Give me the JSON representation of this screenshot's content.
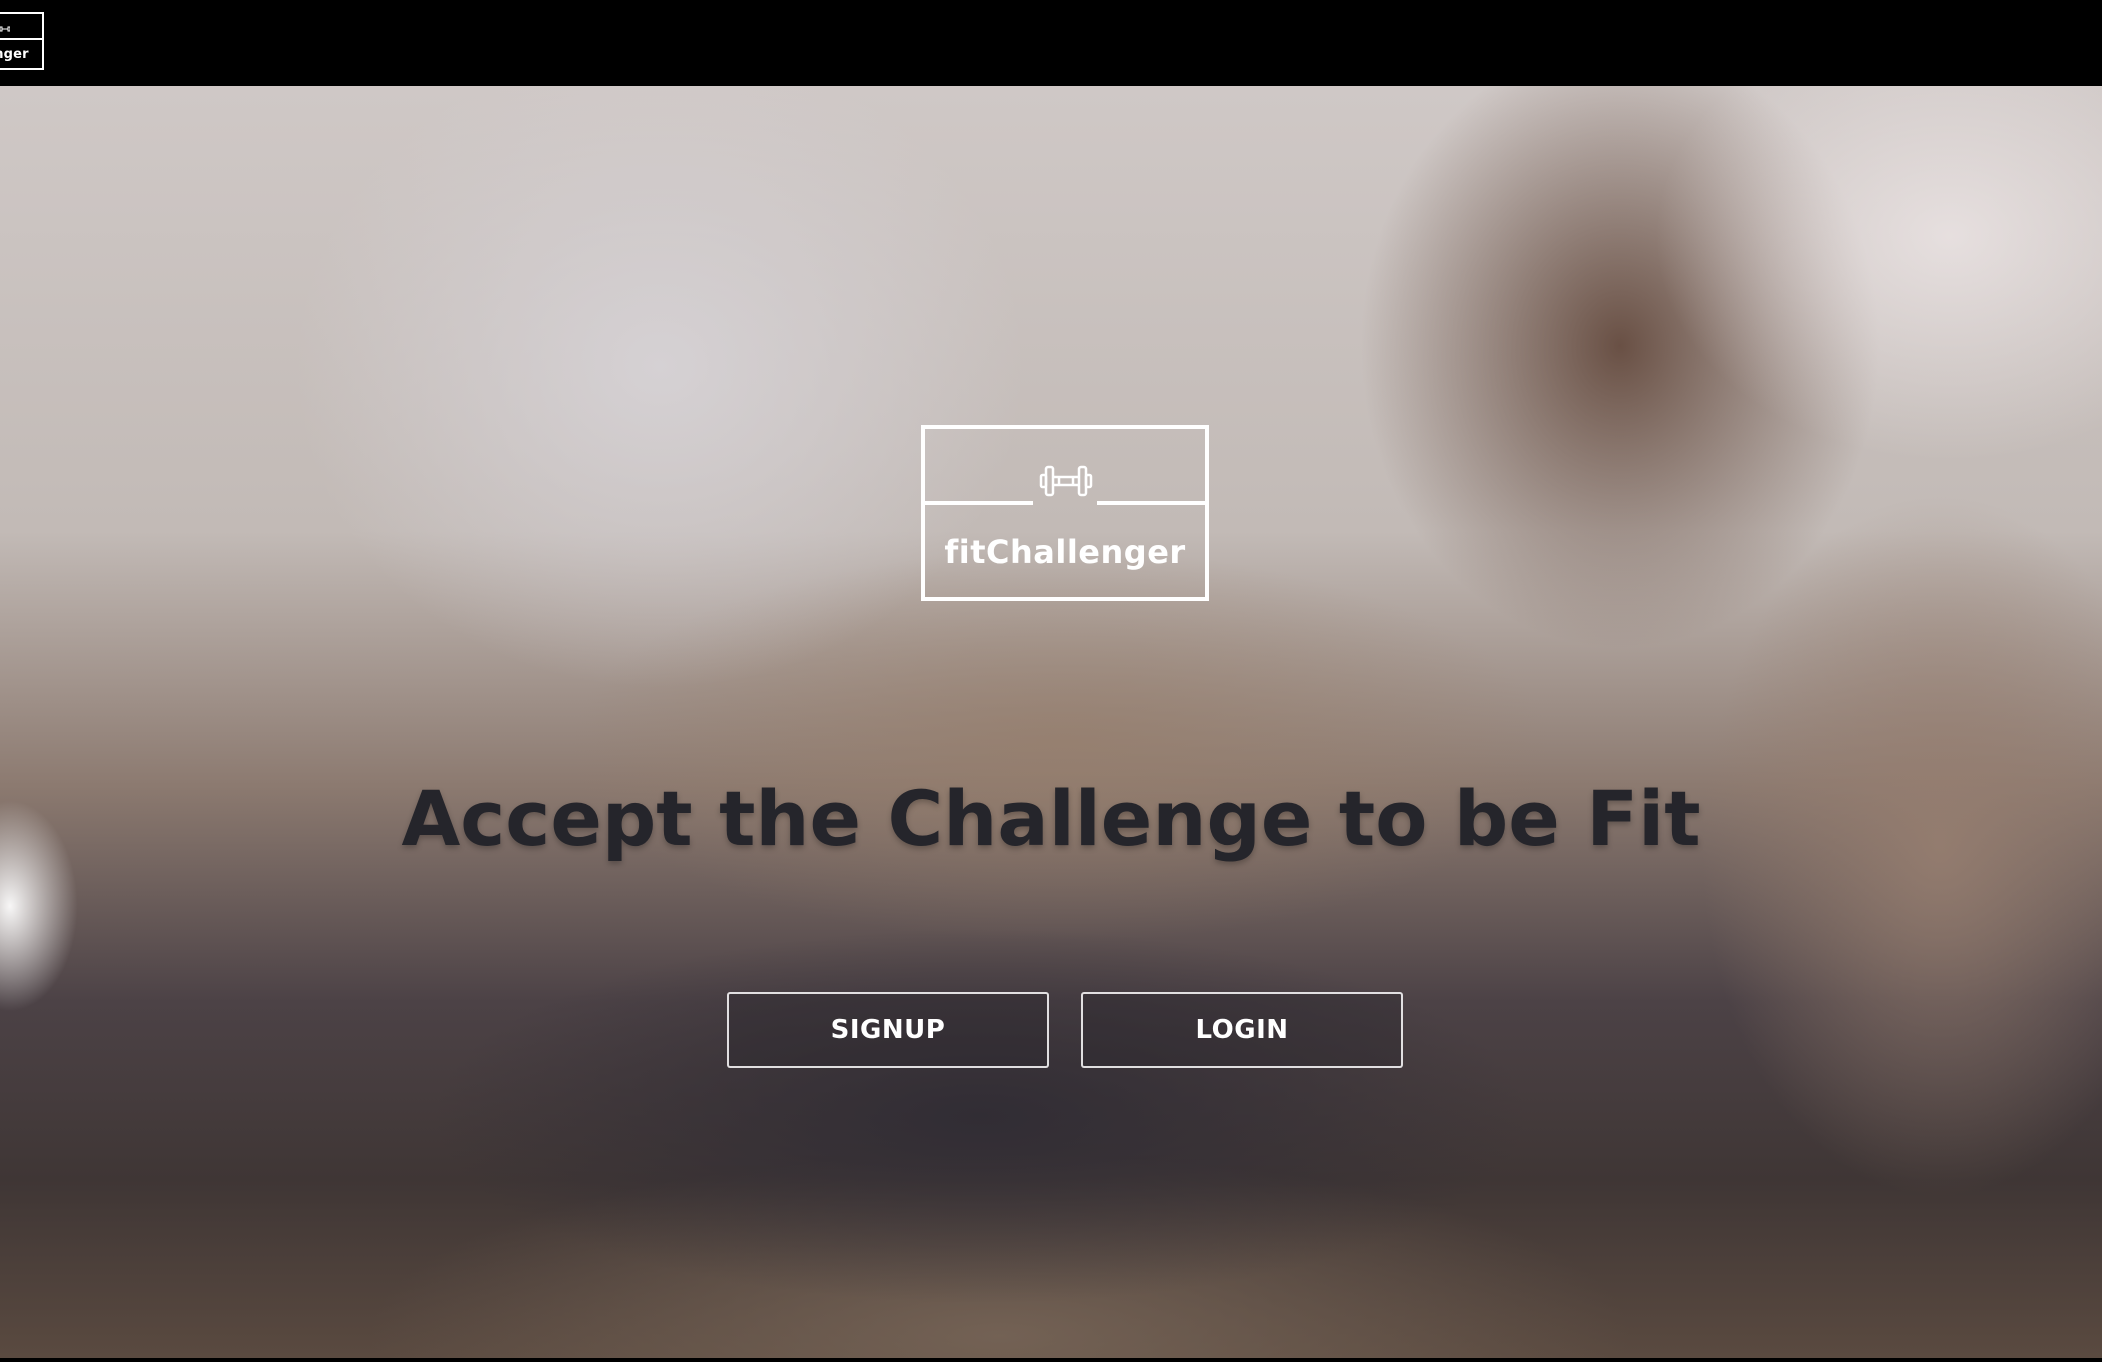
{
  "header": {
    "logo_text": "enger",
    "logo_icon": "dumbbell-icon"
  },
  "hero": {
    "brand_name": "fitChallenger",
    "brand_icon": "dumbbell-icon",
    "tagline": "Accept the Challenge to be Fit",
    "buttons": {
      "signup_label": "SIGNUP",
      "login_label": "LOGIN"
    }
  },
  "colors": {
    "topbar": "#000000",
    "tagline_text": "#25252b",
    "button_text": "#ffffff",
    "logo_stroke": "#ffffff"
  }
}
